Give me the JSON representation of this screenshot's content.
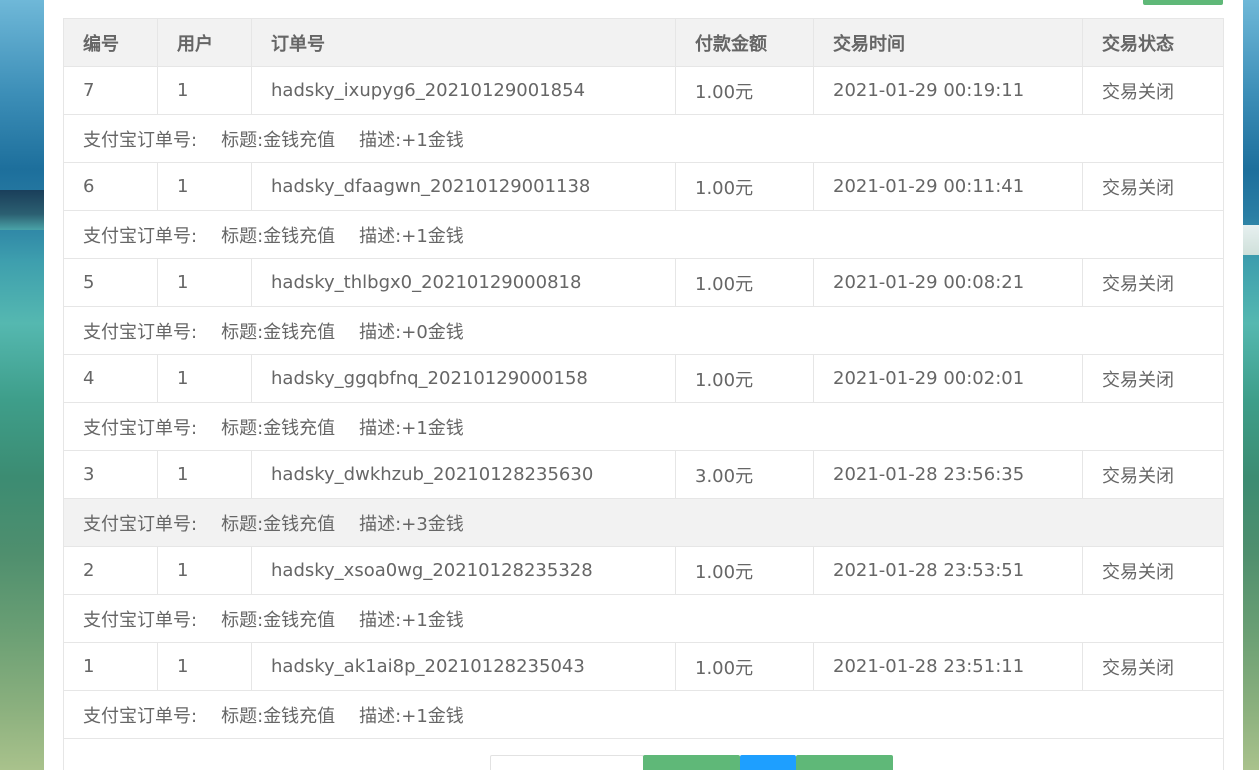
{
  "table": {
    "headers": [
      "编号",
      "用户",
      "订单号",
      "付款金额",
      "交易时间",
      "交易状态"
    ],
    "detail_labels": {
      "alipay": "支付宝订单号:",
      "title": "标题:",
      "desc": "描述:"
    },
    "orders": [
      {
        "id": "7",
        "user": "1",
        "order_no": "hadsky_ixupyg6_20210129001854",
        "amount": "1.00元",
        "time": "2021-01-29 00:19:11",
        "status": "交易关闭",
        "title": "金钱充值",
        "desc": "+1金钱"
      },
      {
        "id": "6",
        "user": "1",
        "order_no": "hadsky_dfaagwn_20210129001138",
        "amount": "1.00元",
        "time": "2021-01-29 00:11:41",
        "status": "交易关闭",
        "title": "金钱充值",
        "desc": "+1金钱"
      },
      {
        "id": "5",
        "user": "1",
        "order_no": "hadsky_thlbgx0_20210129000818",
        "amount": "1.00元",
        "time": "2021-01-29 00:08:21",
        "status": "交易关闭",
        "title": "金钱充值",
        "desc": "+0金钱"
      },
      {
        "id": "4",
        "user": "1",
        "order_no": "hadsky_ggqbfnq_20210129000158",
        "amount": "1.00元",
        "time": "2021-01-29 00:02:01",
        "status": "交易关闭",
        "title": "金钱充值",
        "desc": "+1金钱"
      },
      {
        "id": "3",
        "user": "1",
        "order_no": "hadsky_dwkhzub_20210128235630",
        "amount": "3.00元",
        "time": "2021-01-28 23:56:35",
        "status": "交易关闭",
        "title": "金钱充值",
        "desc": "+3金钱"
      },
      {
        "id": "2",
        "user": "1",
        "order_no": "hadsky_xsoa0wg_20210128235328",
        "amount": "1.00元",
        "time": "2021-01-28 23:53:51",
        "status": "交易关闭",
        "title": "金钱充值",
        "desc": "+1金钱"
      },
      {
        "id": "1",
        "user": "1",
        "order_no": "hadsky_ak1ai8p_20210128235043",
        "amount": "1.00元",
        "time": "2021-01-28 23:51:11",
        "status": "交易关闭",
        "title": "金钱充值",
        "desc": "+1金钱"
      }
    ]
  },
  "colors": {
    "header_bg": "#f2f2f2",
    "border": "#e6e6e6",
    "text": "#666666",
    "button_green": "#5fb878",
    "button_blue": "#1e9fff"
  }
}
